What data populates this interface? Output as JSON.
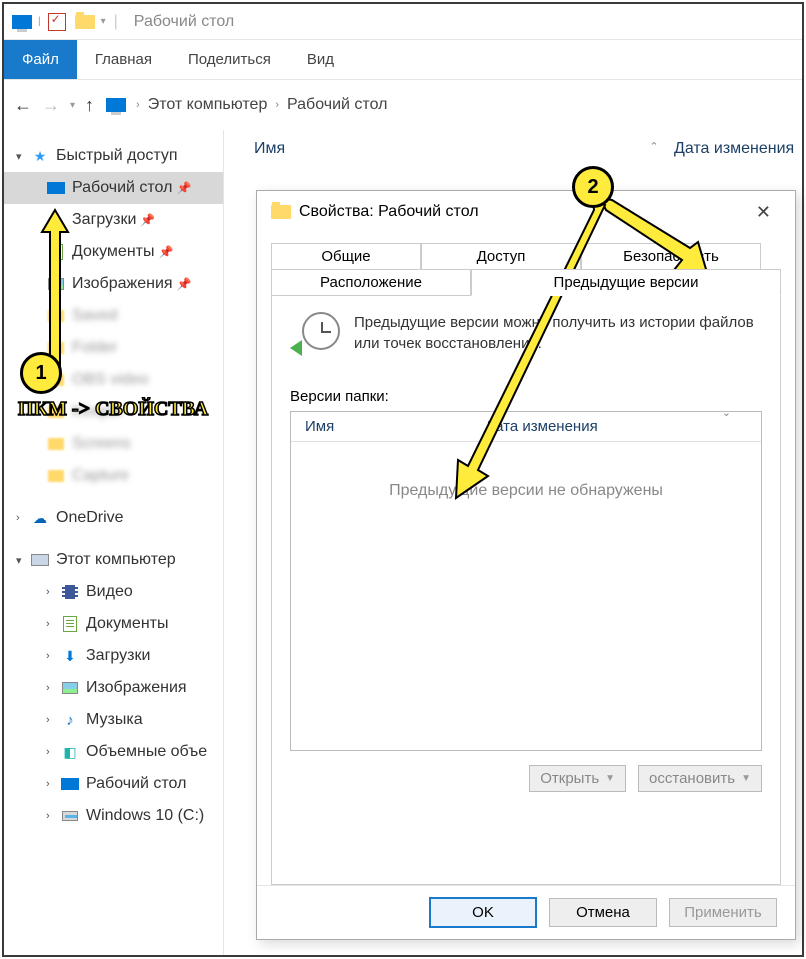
{
  "titlebar": {
    "title": "Рабочий стол"
  },
  "ribbon": {
    "file": "Файл",
    "home": "Главная",
    "share": "Поделиться",
    "view": "Вид"
  },
  "breadcrumb": {
    "pc": "Этот компьютер",
    "desktop": "Рабочий стол"
  },
  "columns": {
    "name": "Имя",
    "date": "Дата изменения"
  },
  "sidebar": {
    "quick": "Быстрый доступ",
    "desktop": "Рабочий стол",
    "downloads": "Загрузки",
    "documents": "Документы",
    "pictures": "Изображения",
    "onedrive": "OneDrive",
    "thispc": "Этот компьютер",
    "videos": "Видео",
    "documents2": "Документы",
    "downloads2": "Загрузки",
    "pictures2": "Изображения",
    "music": "Музыка",
    "objects3d": "Объемные объе",
    "desktop2": "Рабочий стол",
    "cdrive": "Windows 10 (C:)"
  },
  "dialog": {
    "title": "Свойства: Рабочий стол",
    "tabs": {
      "general": "Общие",
      "sharing": "Доступ",
      "security": "Безопасность",
      "location": "Расположение",
      "previous": "Предыдущие версии"
    },
    "desc": "Предыдущие версии можно получить из истории файлов или точек восстановления.",
    "versions_label": "Версии папки:",
    "col_name": "Имя",
    "col_date": "Дата изменения",
    "empty": "Предыдущие версии не обнаружены",
    "open": "Открыть",
    "restore": "осстановить",
    "ok": "OK",
    "cancel": "Отмена",
    "apply": "Применить"
  },
  "annot": {
    "badge1": "1",
    "badge2": "2",
    "text1": "ПКМ -> СВОЙСТВА"
  }
}
